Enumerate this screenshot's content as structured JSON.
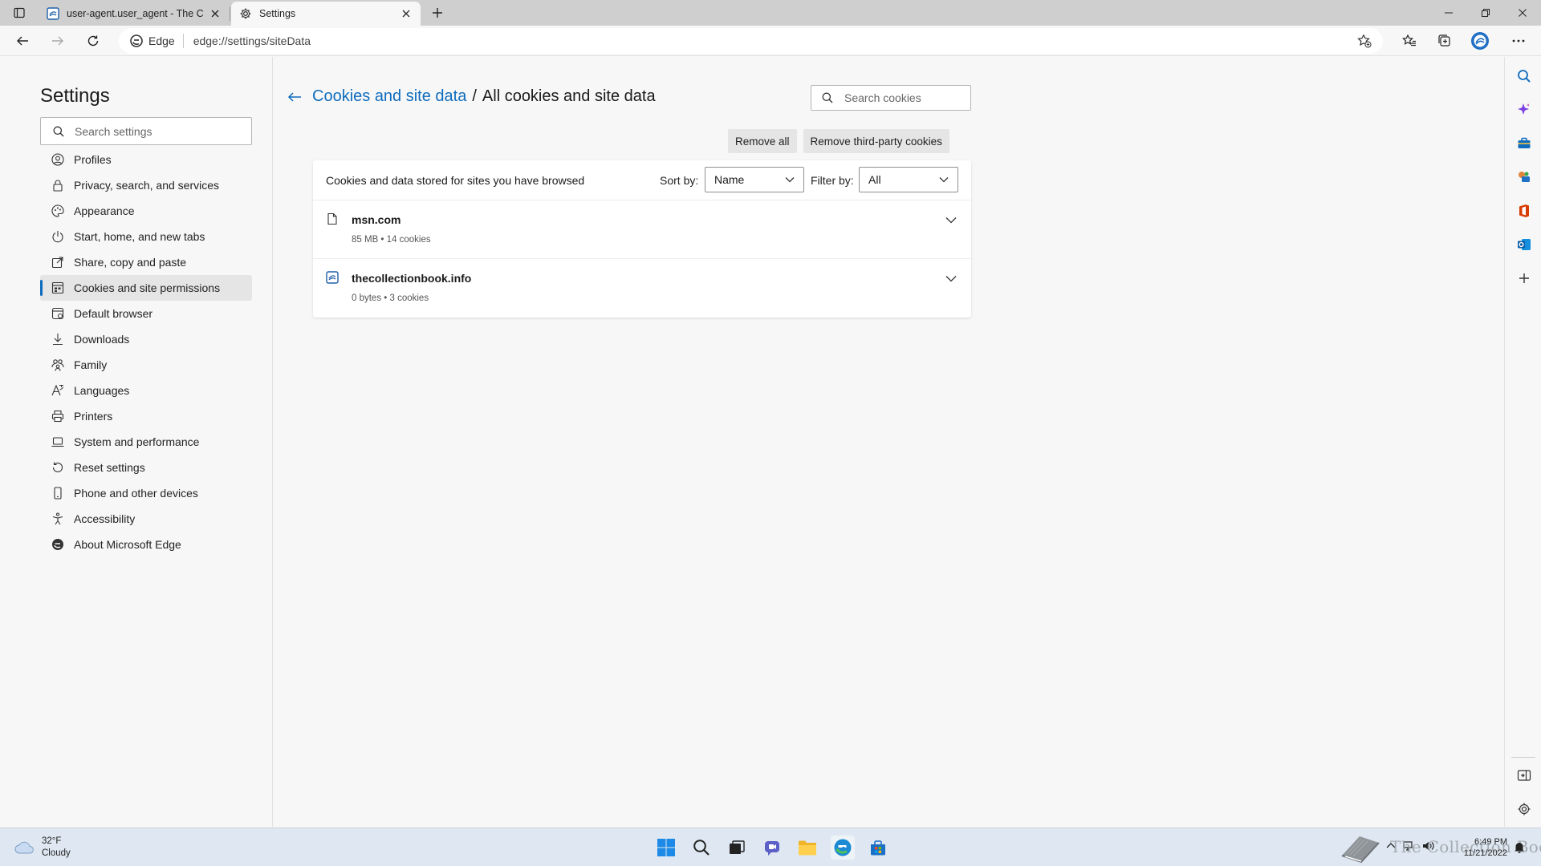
{
  "browser": {
    "tabs": [
      {
        "title": "user-agent.user_agent - The Coll",
        "active": false
      },
      {
        "title": "Settings",
        "active": true
      }
    ],
    "address": {
      "chip_label": "Edge",
      "url": "edge://settings/siteData"
    }
  },
  "sidebar": {
    "title": "Settings",
    "search_placeholder": "Search settings",
    "items": [
      {
        "label": "Profiles",
        "icon": "profile-icon"
      },
      {
        "label": "Privacy, search, and services",
        "icon": "lock-icon"
      },
      {
        "label": "Appearance",
        "icon": "appearance-icon"
      },
      {
        "label": "Start, home, and new tabs",
        "icon": "power-icon"
      },
      {
        "label": "Share, copy and paste",
        "icon": "share-icon"
      },
      {
        "label": "Cookies and site permissions",
        "icon": "cookie-icon",
        "selected": true
      },
      {
        "label": "Default browser",
        "icon": "browser-icon"
      },
      {
        "label": "Downloads",
        "icon": "download-icon"
      },
      {
        "label": "Family",
        "icon": "family-icon"
      },
      {
        "label": "Languages",
        "icon": "language-icon"
      },
      {
        "label": "Printers",
        "icon": "printer-icon"
      },
      {
        "label": "System and performance",
        "icon": "laptop-icon"
      },
      {
        "label": "Reset settings",
        "icon": "reset-icon"
      },
      {
        "label": "Phone and other devices",
        "icon": "phone-icon"
      },
      {
        "label": "Accessibility",
        "icon": "accessibility-icon"
      },
      {
        "label": "About Microsoft Edge",
        "icon": "edge-icon"
      }
    ]
  },
  "main": {
    "breadcrumb_parent": "Cookies and site data",
    "breadcrumb_sep": "/",
    "breadcrumb_current": "All cookies and site data",
    "search_placeholder": "Search cookies",
    "remove_all_label": "Remove all",
    "remove_third_party_label": "Remove third-party cookies",
    "card_title": "Cookies and data stored for sites you have browsed",
    "sort_label": "Sort by:",
    "sort_value": "Name",
    "filter_label": "Filter by:",
    "filter_value": "All",
    "sites": [
      {
        "name": "msn.com",
        "meta": "85 MB • 14 cookies",
        "icon": "page-icon"
      },
      {
        "name": "thecollectionbook.info",
        "meta": "0 bytes • 3 cookies",
        "icon": "site-favicon-icon"
      }
    ]
  },
  "taskbar": {
    "temperature": "32°F",
    "condition": "Cloudy",
    "time": "6:49 PM",
    "date": "11/21/2022",
    "watermark": "The Collection Book"
  },
  "colors": {
    "accent": "#0f6cbd",
    "background": "#f7f7f7",
    "tabstrip": "#cfcfcf",
    "taskbar": "#dfe8f2"
  }
}
